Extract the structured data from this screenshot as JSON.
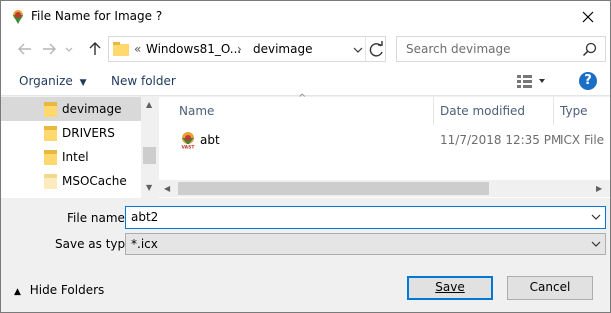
{
  "window": {
    "title": "File Name for Image ?"
  },
  "address": {
    "crumb_prefix": "«",
    "crumb_parent": "Windows81_O...",
    "crumb_current": "devimage"
  },
  "search": {
    "placeholder": "Search devimage"
  },
  "toolbar": {
    "organize_label": "Organize",
    "new_folder_label": "New folder",
    "help_label": "?"
  },
  "nav": {
    "items": [
      {
        "label": "devimage"
      },
      {
        "label": "DRIVERS"
      },
      {
        "label": "Intel"
      },
      {
        "label": "MSOCache"
      }
    ]
  },
  "files": {
    "columns": [
      "Name",
      "Date modified",
      "Type"
    ],
    "rows": [
      {
        "name": "abt",
        "date": "11/7/2018 12:35 PM",
        "type": "ICX File"
      }
    ]
  },
  "form": {
    "file_name_label": "File name:",
    "file_name_value": "abt2",
    "save_as_type_label": "Save as type:",
    "save_as_type_value": "*.icx"
  },
  "footer": {
    "hide_folders_label": "Hide Folders",
    "save_label": "Save",
    "cancel_label": "Cancel"
  },
  "colors": {
    "accent": "#0078d7",
    "folder": "#ffd86e",
    "selection": "#d9d9d9"
  }
}
